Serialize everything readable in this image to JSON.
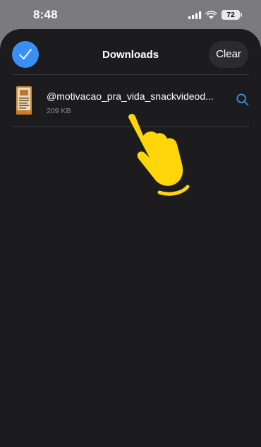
{
  "status_bar": {
    "time": "8:48",
    "battery": "72",
    "icons": [
      "signal-icon",
      "wifi-icon",
      "battery-icon"
    ]
  },
  "sheet": {
    "title": "Downloads",
    "clear_label": "Clear",
    "select_all_icon": "checkmark-icon"
  },
  "downloads": [
    {
      "filename": "@motivacao_pra_vida_snackvideod...",
      "size": "209 KB",
      "action_icon": "search-icon"
    }
  ],
  "overlay": {
    "icon": "tap-hand-icon",
    "color": "#FFD60A"
  },
  "colors": {
    "accent": "#3A8FF5",
    "sheet_background": "#1C1C1E",
    "hand": "#FFD60A"
  }
}
